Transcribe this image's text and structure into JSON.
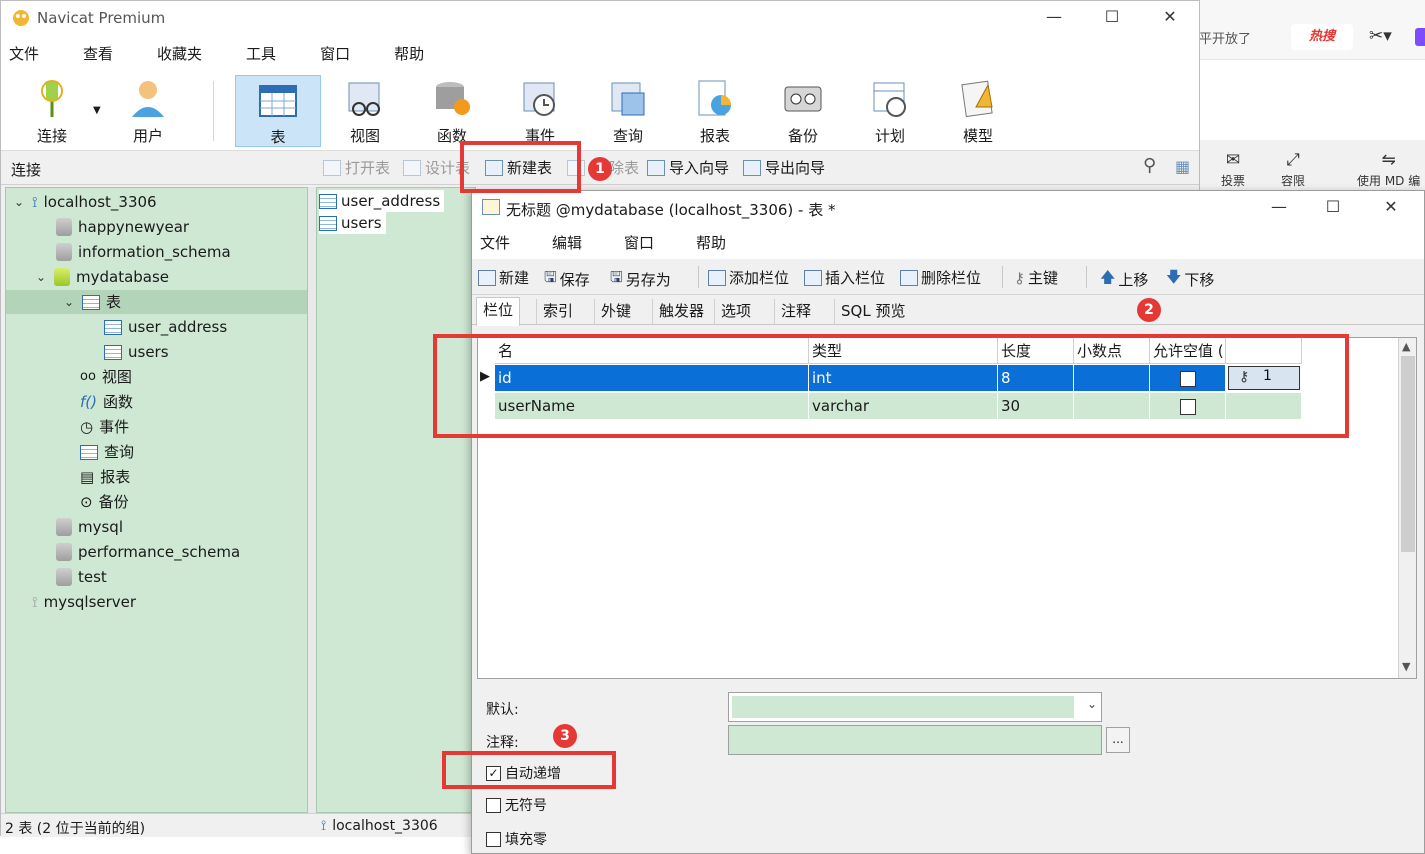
{
  "background_browser": {
    "hint_text": "平开放了",
    "hot_search": "热搜",
    "tools": [
      "投票",
      "容限",
      "使用 MD 编"
    ]
  },
  "navicat": {
    "title": "Navicat Premium",
    "menu": [
      "文件",
      "查看",
      "收藏夹",
      "工具",
      "窗口",
      "帮助"
    ],
    "toolbar": [
      "连接",
      "用户",
      "表",
      "视图",
      "函数",
      "事件",
      "查询",
      "报表",
      "备份",
      "计划",
      "模型"
    ],
    "subbar": {
      "connection_label": "连接",
      "open_table": "打开表",
      "design_table": "设计表",
      "new_table": "新建表",
      "delete_table": "除表",
      "import_wizard": "导入向导",
      "export_wizard": "导出向导"
    },
    "tree": {
      "connection": "localhost_3306",
      "databases_above": [
        "happynewyear",
        "information_schema"
      ],
      "open_db": "mydatabase",
      "tables_node": "表",
      "tables": [
        "user_address",
        "users"
      ],
      "db_objects": [
        "视图",
        "函数",
        "事件",
        "查询",
        "报表",
        "备份"
      ],
      "databases_below": [
        "mysql",
        "performance_schema",
        "test"
      ],
      "other_connection": "mysqlserver"
    },
    "mid_list": [
      "user_address",
      "users"
    ],
    "status_left": "2 表 (2 位于当前的组)",
    "status_conn": "localhost_3306"
  },
  "design": {
    "title": "无标题 @mydatabase (localhost_3306) - 表 *",
    "menu": [
      "文件",
      "编辑",
      "窗口",
      "帮助"
    ],
    "toolbar": {
      "new": "新建",
      "save": "保存",
      "save_as": "另存为",
      "add_field": "添加栏位",
      "insert_field": "插入栏位",
      "delete_field": "删除栏位",
      "primary_key": "主键",
      "move_up": "上移",
      "move_down": "下移"
    },
    "tabs": [
      "栏位",
      "索引",
      "外键",
      "触发器",
      "选项",
      "注释",
      "SQL 预览"
    ],
    "columns": [
      "名",
      "类型",
      "长度",
      "小数点",
      "允许空值 ("
    ],
    "rows": [
      {
        "name": "id",
        "type": "int",
        "length": "8",
        "decimals": "",
        "key": "1"
      },
      {
        "name": "userName",
        "type": "varchar",
        "length": "30",
        "decimals": "",
        "key": ""
      }
    ],
    "props": {
      "default_label": "默认:",
      "comment_label": "注释:",
      "ellipsis": "...",
      "auto_increment": "自动递增",
      "unsigned": "无符号",
      "zerofill": "填充零"
    }
  },
  "annotations": [
    "1",
    "2",
    "3"
  ],
  "colors": {
    "selection_blue": "#0a6fd6",
    "pale_green": "#cfe8d4",
    "annotation_red": "#e53935"
  }
}
